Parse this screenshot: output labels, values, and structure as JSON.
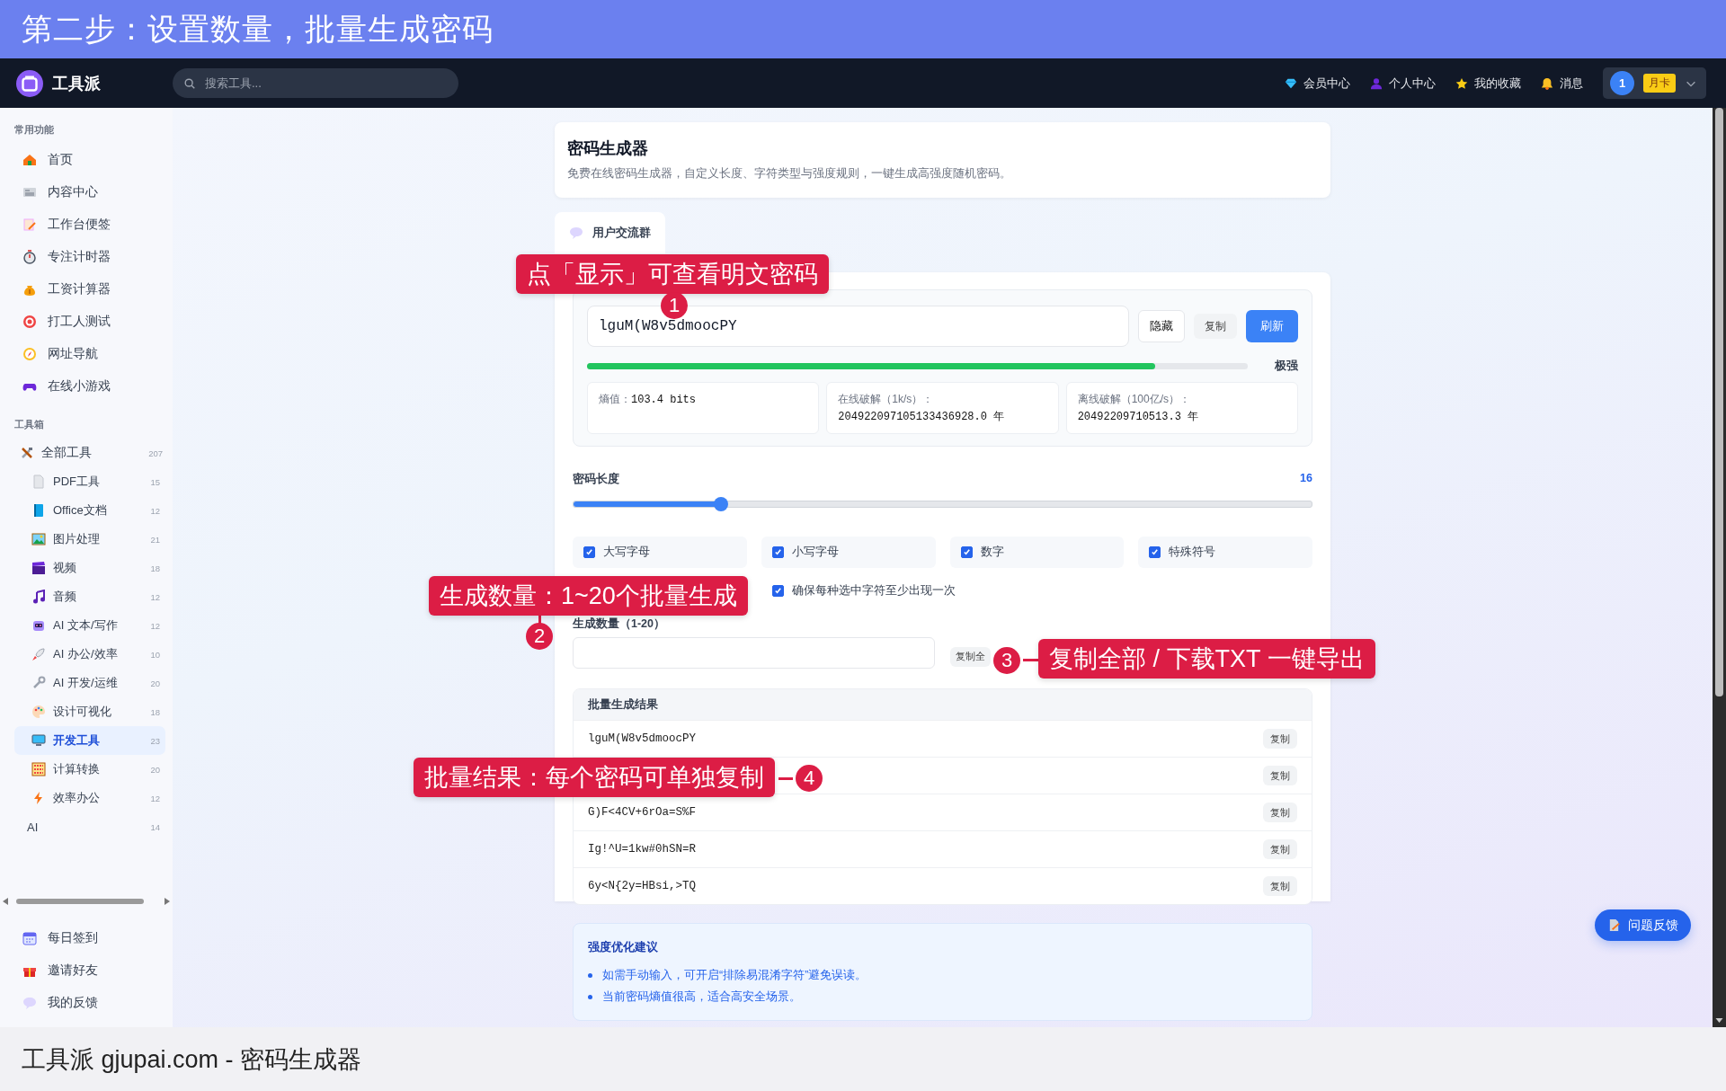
{
  "banner": {
    "title": "第二步：设置数量，批量生成密码"
  },
  "header": {
    "logo": "工具派",
    "search": {
      "placeholder": "搜索工具..."
    },
    "nav": [
      "会员中心",
      "个人中心",
      "我的收藏",
      "消息"
    ],
    "user": {
      "avatar": "1",
      "badge": "月卡"
    }
  },
  "sidebar": {
    "sections": [
      {
        "title": "常用功能",
        "items": [
          {
            "label": "首页",
            "selected": false
          },
          {
            "label": "内容中心",
            "selected": false
          },
          {
            "label": "工作台便签",
            "selected": false
          },
          {
            "label": "专注计时器",
            "selected": false
          },
          {
            "label": "工资计算器",
            "selected": false
          },
          {
            "label": "打工人测试",
            "selected": false
          },
          {
            "label": "网址导航",
            "selected": false
          },
          {
            "label": "在线小游戏",
            "selected": false
          }
        ]
      },
      {
        "title": "工具箱",
        "items": [
          {
            "label": "全部工具",
            "count": "207",
            "selected": false,
            "children": [
              {
                "label": "PDF工具",
                "count": "15",
                "selected": false
              },
              {
                "label": "Office文档",
                "count": "12",
                "selected": false
              },
              {
                "label": "图片处理",
                "count": "21",
                "selected": false
              },
              {
                "label": "视频",
                "count": "18",
                "selected": false
              },
              {
                "label": "音频",
                "count": "12",
                "selected": false
              },
              {
                "label": "AI 文本/写作",
                "count": "12",
                "selected": false
              },
              {
                "label": "AI 办公/效率",
                "count": "10",
                "selected": false
              },
              {
                "label": "AI 开发/运维",
                "count": "20",
                "selected": false
              },
              {
                "label": "设计可视化",
                "count": "18",
                "selected": false
              },
              {
                "label": "开发工具",
                "count": "23",
                "selected": true
              },
              {
                "label": "计算转换",
                "count": "20",
                "selected": false
              },
              {
                "label": "效率办公",
                "count": "12",
                "selected": false
              },
              {
                "label": "AI",
                "count": "14",
                "selected": false
              }
            ]
          }
        ]
      }
    ],
    "bottom_items": [
      {
        "label": "每日签到"
      },
      {
        "label": "邀请好友"
      },
      {
        "label": "我的反馈"
      }
    ]
  },
  "page": {
    "title": "密码生成器",
    "subtitle": "免费在线密码生成器，自定义长度、字符类型与强度规则，一键生成高强度随机密码。"
  },
  "tabs": [
    {
      "label": "用户交流群",
      "selected": true
    }
  ],
  "generator": {
    "password": "lguM(W8v5dmoocPY",
    "buttons": [
      {
        "label": "隐藏",
        "kind": "outline"
      },
      {
        "label": "复制",
        "kind": "ghost"
      },
      {
        "label": "刷新",
        "kind": "primary"
      }
    ],
    "strength": {
      "level": 0.86,
      "label": "极强"
    },
    "stats": [
      {
        "label": "熵值：",
        "value": "103.4 bits"
      },
      {
        "label": "在线破解（1k/s）：",
        "value": "204922097105133436928.0 年"
      },
      {
        "label": "离线破解（100亿/s）：",
        "value": "20492209710513.3 年"
      }
    ],
    "length": {
      "label": "密码长度",
      "value": "16",
      "level": 0.2
    },
    "options": [
      {
        "label": "大写字母",
        "checked": true
      },
      {
        "label": "小写字母",
        "checked": true
      },
      {
        "label": "数字",
        "checked": true
      },
      {
        "label": "特殊符号",
        "checked": true
      }
    ],
    "ensure": {
      "label": "确保每种选中字符至少出现一次",
      "checked": true
    },
    "count": {
      "label": "生成数量（1-20）"
    },
    "export_button": "复制全"
  },
  "results": {
    "title": "批量生成结果",
    "rows": [
      {
        "password": "lguM(W8v5dmoocPY",
        "copy": "复制"
      },
      {
        "copy": "复制"
      },
      {
        "password": "G)F<4CV+6rOa=S%F",
        "copy": "复制"
      },
      {
        "password": "Ig!^U=1kw#0hSN=R",
        "copy": "复制"
      },
      {
        "password": "6y<N{2y=HBsi,>TQ",
        "copy": "复制"
      }
    ]
  },
  "tips": {
    "title": "强度优化建议",
    "items": [
      "如需手动输入，可开启“排除易混淆字符”避免误读。",
      "当前密码熵值很高，适合高安全场景。"
    ]
  },
  "feedback_button": "问题反馈",
  "annotations": [
    {
      "number": "1",
      "text": "点「显示」可查看明文密码"
    },
    {
      "number": "2",
      "text": "生成数量：1~20个批量生成"
    },
    {
      "number": "3",
      "text": "复制全部 / 下载TXT 一键导出"
    },
    {
      "number": "4",
      "text": "批量结果：每个密码可单独复制"
    }
  ],
  "caption": "工具派 gjupai.com - 密码生成器"
}
